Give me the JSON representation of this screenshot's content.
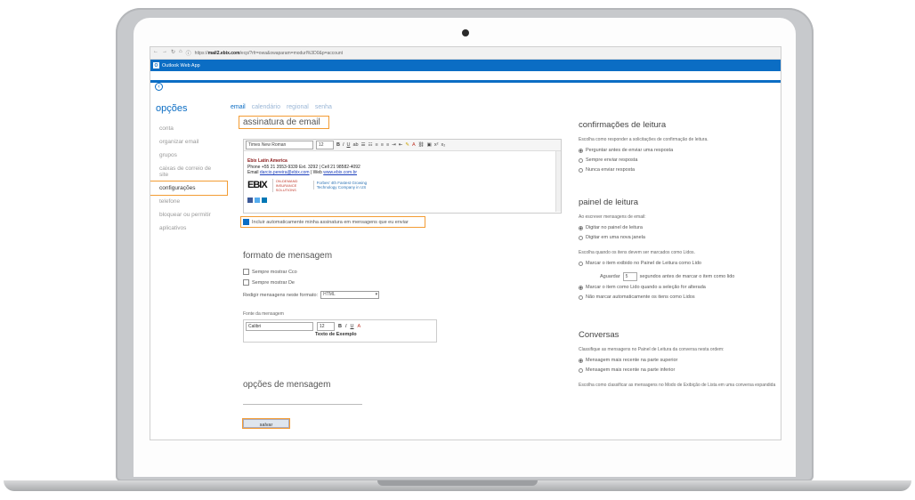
{
  "browser": {
    "url_prefix": "https://",
    "url_host": "mail2.ebix.com",
    "url_path": "/ecp/?rfr=owa&owaparam=modurl%3D0&p=account"
  },
  "app": {
    "logo_letter": "O",
    "title": "Outlook Web App"
  },
  "sidebar": {
    "heading": "opções",
    "items": [
      {
        "label": "conta"
      },
      {
        "label": "organizar email"
      },
      {
        "label": "grupos"
      },
      {
        "label": "caixas de correio de site"
      },
      {
        "label": "configurações"
      },
      {
        "label": "telefone"
      },
      {
        "label": "bloquear ou permitir"
      },
      {
        "label": "aplicativos"
      }
    ]
  },
  "tabs": [
    "email",
    "calendário",
    "regional",
    "senha"
  ],
  "signature": {
    "title": "assinatura de email",
    "font": "Times New Roman",
    "size": "12",
    "company": "Ebix Latin America",
    "phone_line": "Phone +55 21 3553-9339 Ext. 3292 | Cell 21 98582-4092",
    "email_prefix": "Email",
    "email": "darcio.pereira@ebix.com",
    "web_prefix": "| Web",
    "web": "www.ebix.com.br",
    "logo_text": "EBIX",
    "tagline1": "ON-DEMAND INSURANCE SOLUTIONS",
    "tagline2": "Forbes' 4th Fastest Growing Technology Company in US",
    "auto_include": "Incluir automaticamente minha assinatura em mensagens que eu enviar"
  },
  "message_format": {
    "title": "formato de mensagem",
    "always_cc": "Sempre mostrar Cco",
    "always_from": "Sempre mostrar De",
    "compose_label": "Redigir mensagens neste formato:",
    "compose_value": "HTML",
    "font_label": "Fonte da mensagem",
    "font": "Calibri",
    "size": "12",
    "sample": "Texto de Exemplo"
  },
  "message_options": {
    "title": "opções de mensagem"
  },
  "save_label": "salvar",
  "read_receipts": {
    "title": "confirmações de leitura",
    "desc": "Escolha como responder a solicitações de confirmação de leitura.",
    "opt1": "Perguntar antes de enviar uma resposta",
    "opt2": "Sempre enviar resposta",
    "opt3": "Nunca enviar resposta"
  },
  "reading_pane": {
    "title": "painel de leitura",
    "desc": "Ao escrever mensagens de email:",
    "opt1": "Digitar no painel de leitura",
    "opt2": "Digitar em uma nova janela",
    "desc2": "Escolha quando os itens devem ser marcados como Lidos.",
    "opt3": "Marcar o item exibido no Painel de Leitura como Lido",
    "wait_prefix": "Aguardar",
    "wait_value": "5",
    "wait_suffix": "segundos antes de marcar o item como lido",
    "opt4": "Marcar o item como Lido quando a seleção for alterada",
    "opt5": "Não marcar automaticamente os itens como Lidos"
  },
  "conversations": {
    "title": "Conversas",
    "desc": "Classifique as mensagens no Painel de Leitura da conversa nesta ordem:",
    "opt1": "Mensagem mais recente na parte superior",
    "opt2": "Mensagem mais recente na parte inferior",
    "desc2": "Escolha como classificar as mensagens no Modo de Exibição de Lista em uma conversa expandida"
  }
}
